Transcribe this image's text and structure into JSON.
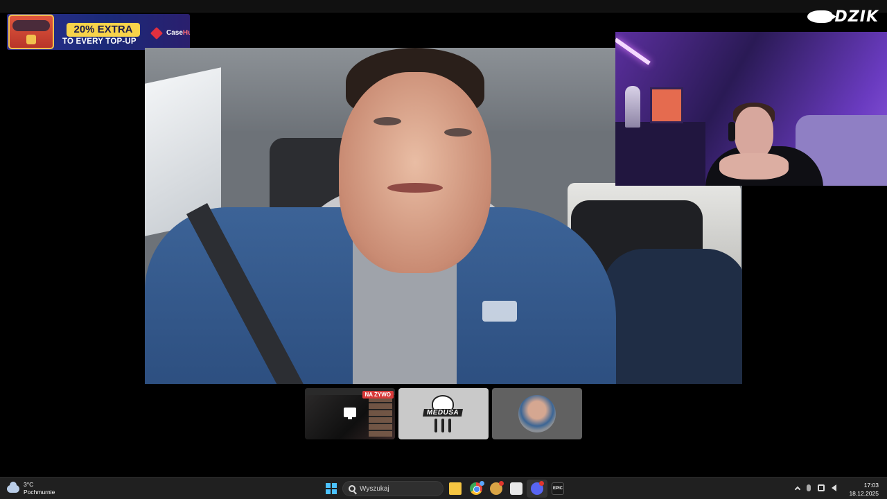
{
  "banner": {
    "promo_line1": "20% EXTRA",
    "promo_line2": "TO EVERY TOP-UP",
    "brand_part1": "Case",
    "brand_part2": "Hug"
  },
  "watermark": {
    "icon": "boar-icon",
    "text": "DZIK"
  },
  "participants": [
    {
      "type": "screen-share",
      "badge": "NA ŻYWO",
      "icon": "present-screen-icon"
    },
    {
      "type": "logo",
      "label": "MEDUSA"
    },
    {
      "type": "camera",
      "icon": "avatar"
    }
  ],
  "taskbar": {
    "weather": {
      "temp": "3°C",
      "condition": "Pochmurnie",
      "icon": "cloud-icon"
    },
    "search_placeholder": "Wyszukaj",
    "apps": [
      {
        "name": "file-explorer",
        "icon": "folder-icon"
      },
      {
        "name": "chrome",
        "icon": "chrome-icon"
      },
      {
        "name": "app",
        "icon": "app-icon"
      },
      {
        "name": "app",
        "icon": "app-icon"
      },
      {
        "name": "discord",
        "icon": "discord-icon",
        "active": true
      },
      {
        "name": "epic-games",
        "icon": "epic-icon",
        "label": "EPIC"
      }
    ],
    "time": "17:03",
    "date": "18.12.2025"
  },
  "colors": {
    "accent_windows": "#4cc2ff",
    "live_badge": "#d83a3a",
    "discord": "#5865f2"
  }
}
